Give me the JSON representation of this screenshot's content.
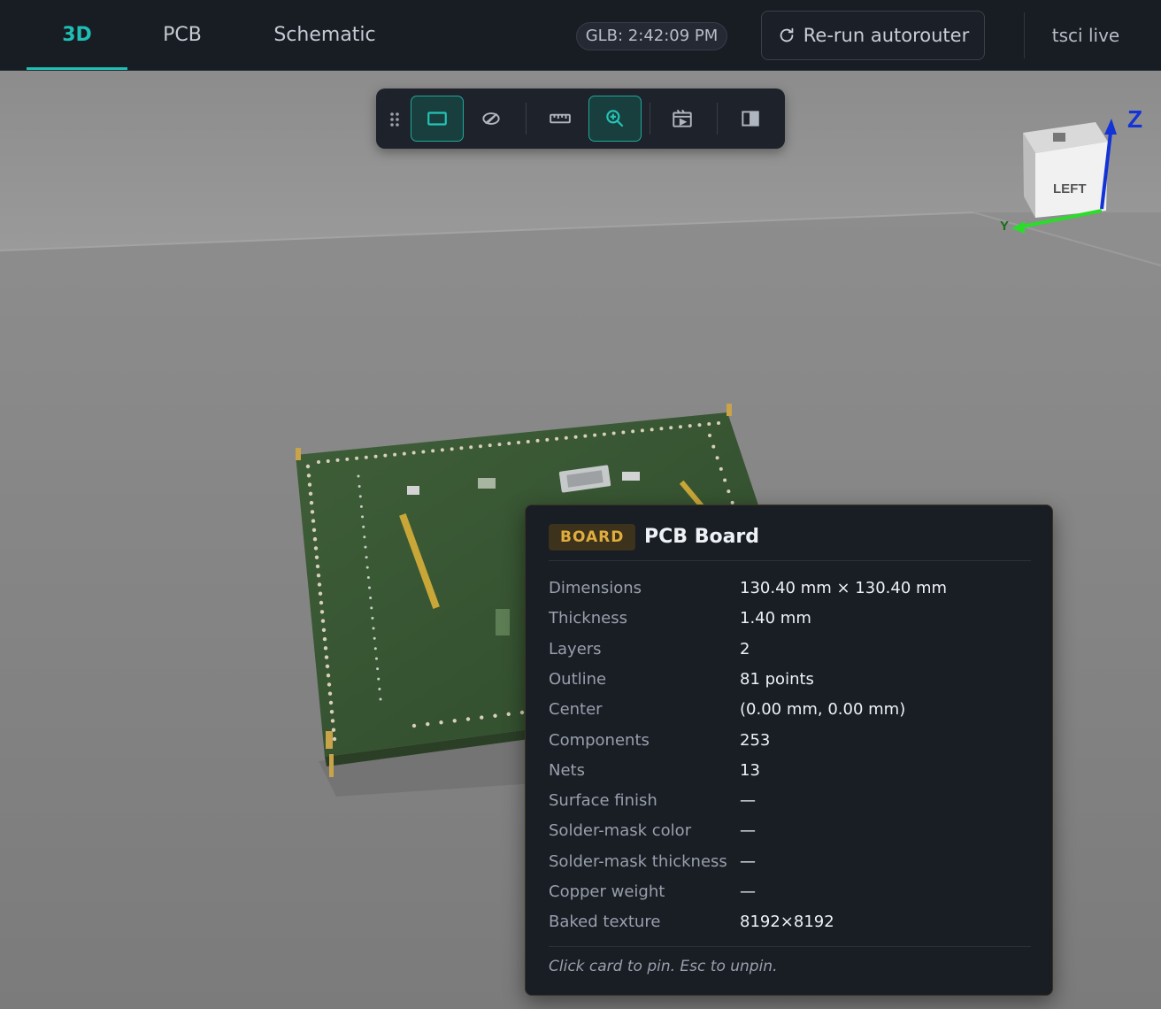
{
  "tabs": [
    {
      "label": "3D",
      "active": true
    },
    {
      "label": "PCB",
      "active": false
    },
    {
      "label": "Schematic",
      "active": false
    }
  ],
  "status": {
    "glb_time": "GLB: 2:42:09 PM"
  },
  "actions": {
    "rerun_label": "Re-run autorouter"
  },
  "source": {
    "label": "tsci live"
  },
  "toolbar": {
    "buttons": [
      {
        "icon": "drag-handle-icon",
        "active": false
      },
      {
        "icon": "box-view-icon",
        "active": true
      },
      {
        "icon": "hide-surface-icon",
        "active": false
      },
      {
        "icon": "ruler-icon",
        "active": false
      },
      {
        "icon": "zoom-inspect-icon",
        "active": true
      },
      {
        "icon": "animation-icon",
        "active": false
      },
      {
        "icon": "split-panel-icon",
        "active": false
      }
    ]
  },
  "gizmo": {
    "face_label": "LEFT",
    "axes": [
      "Z",
      "Y"
    ]
  },
  "card": {
    "badge": "BOARD",
    "title": "PCB Board",
    "rows": [
      {
        "key": "Dimensions",
        "value": "130.40 mm × 130.40 mm"
      },
      {
        "key": "Thickness",
        "value": "1.40 mm"
      },
      {
        "key": "Layers",
        "value": "2"
      },
      {
        "key": "Outline",
        "value": "81 points"
      },
      {
        "key": "Center",
        "value": "(0.00 mm, 0.00 mm)"
      },
      {
        "key": "Components",
        "value": "253"
      },
      {
        "key": "Nets",
        "value": "13"
      },
      {
        "key": "Surface finish",
        "value": "—"
      },
      {
        "key": "Solder-mask color",
        "value": "—"
      },
      {
        "key": "Solder-mask thickness",
        "value": "—"
      },
      {
        "key": "Copper weight",
        "value": "—"
      },
      {
        "key": "Baked texture",
        "value": "8192×8192"
      }
    ],
    "hint": "Click card to pin. Esc to unpin."
  },
  "colors": {
    "accent": "#1fbfb4",
    "board": "#3b5a36",
    "badge_text": "#e0ad3e",
    "background": "#8e8e8e"
  }
}
